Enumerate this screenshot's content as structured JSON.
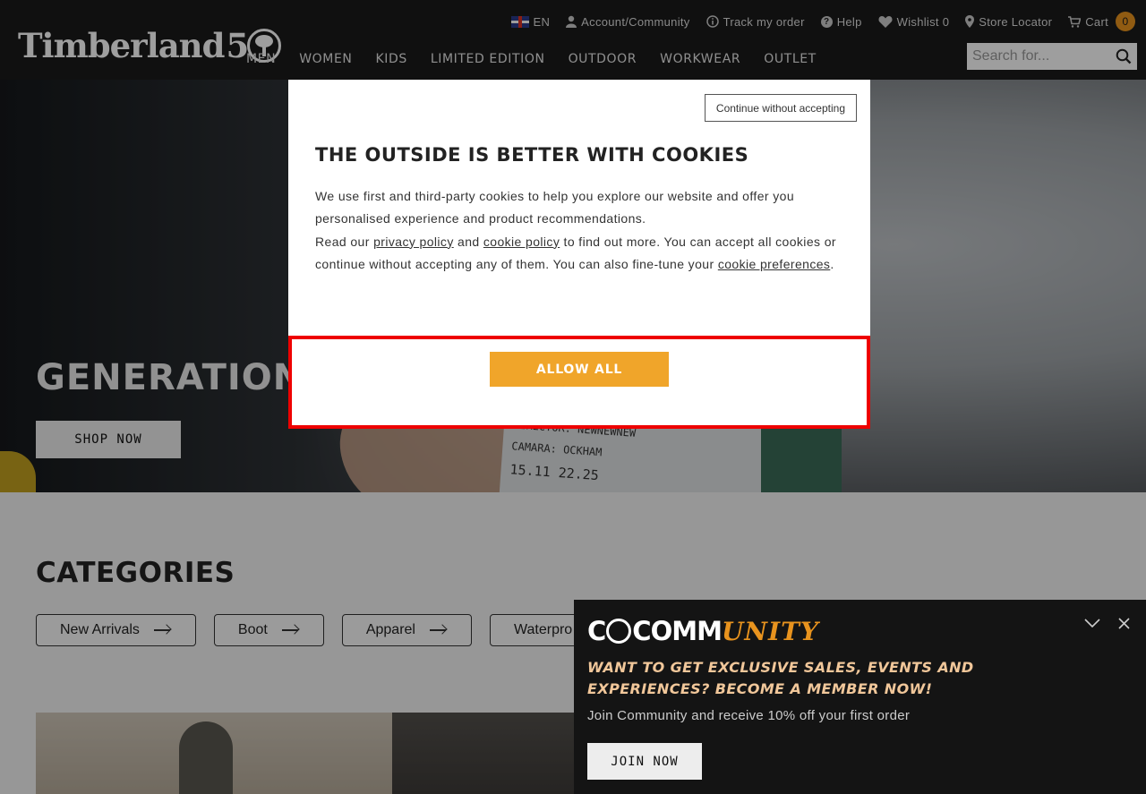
{
  "header": {
    "logo": {
      "text": "Timberland",
      "anniversary": "5"
    },
    "utility": {
      "language": "EN",
      "account": "Account/Community",
      "track_order": "Track my order",
      "help": "Help",
      "wishlist": "Wishlist 0",
      "store_locator": "Store Locator",
      "cart": "Cart",
      "cart_count": "0"
    },
    "nav": [
      "MEN",
      "WOMEN",
      "KIDS",
      "LIMITED EDITION",
      "OUTDOOR",
      "WORKWEAR",
      "OUTLET"
    ],
    "search": {
      "placeholder": "Search for..."
    }
  },
  "hero": {
    "title": "GENERATION",
    "cta": "SHOP NOW",
    "clapboard": [
      "DIRECTOR: NEWNEWNEW",
      "CAMARA: OCKHAM",
      "15.11 22.25"
    ]
  },
  "categories": {
    "title": "CATEGORIES",
    "items": [
      "New Arrivals",
      "Boot",
      "Apparel",
      "Waterpro"
    ]
  },
  "cookie_modal": {
    "continue_label": "Continue without accepting",
    "title": "THE OUTSIDE IS BETTER WITH COOKIES",
    "para1": "We use first and third-party cookies to help you explore our website and offer you personalised experience and product recommendations.",
    "para2_prefix": "Read our ",
    "privacy_link": "privacy policy",
    "and": " and ",
    "cookie_link": "cookie policy",
    "para2_mid": " to find out more. You can accept all cookies or continue without accepting any of them. You can also fine-tune your ",
    "prefs_link": "cookie preferences",
    "para2_end": ".",
    "allow_label": "ALLOW ALL"
  },
  "community": {
    "logo_word": "COMM",
    "logo_script": "UNITY",
    "headline": "WANT TO GET EXCLUSIVE SALES, EVENTS AND EXPERIENCES? BECOME A MEMBER NOW!",
    "subtext": "Join Community and receive 10% off your first order",
    "join_label": "JOIN NOW"
  },
  "colors": {
    "accent_orange": "#f0a52a",
    "header_bg": "#1a1a1a",
    "highlight_red": "#ee0000",
    "community_headline": "#f1c79a"
  }
}
